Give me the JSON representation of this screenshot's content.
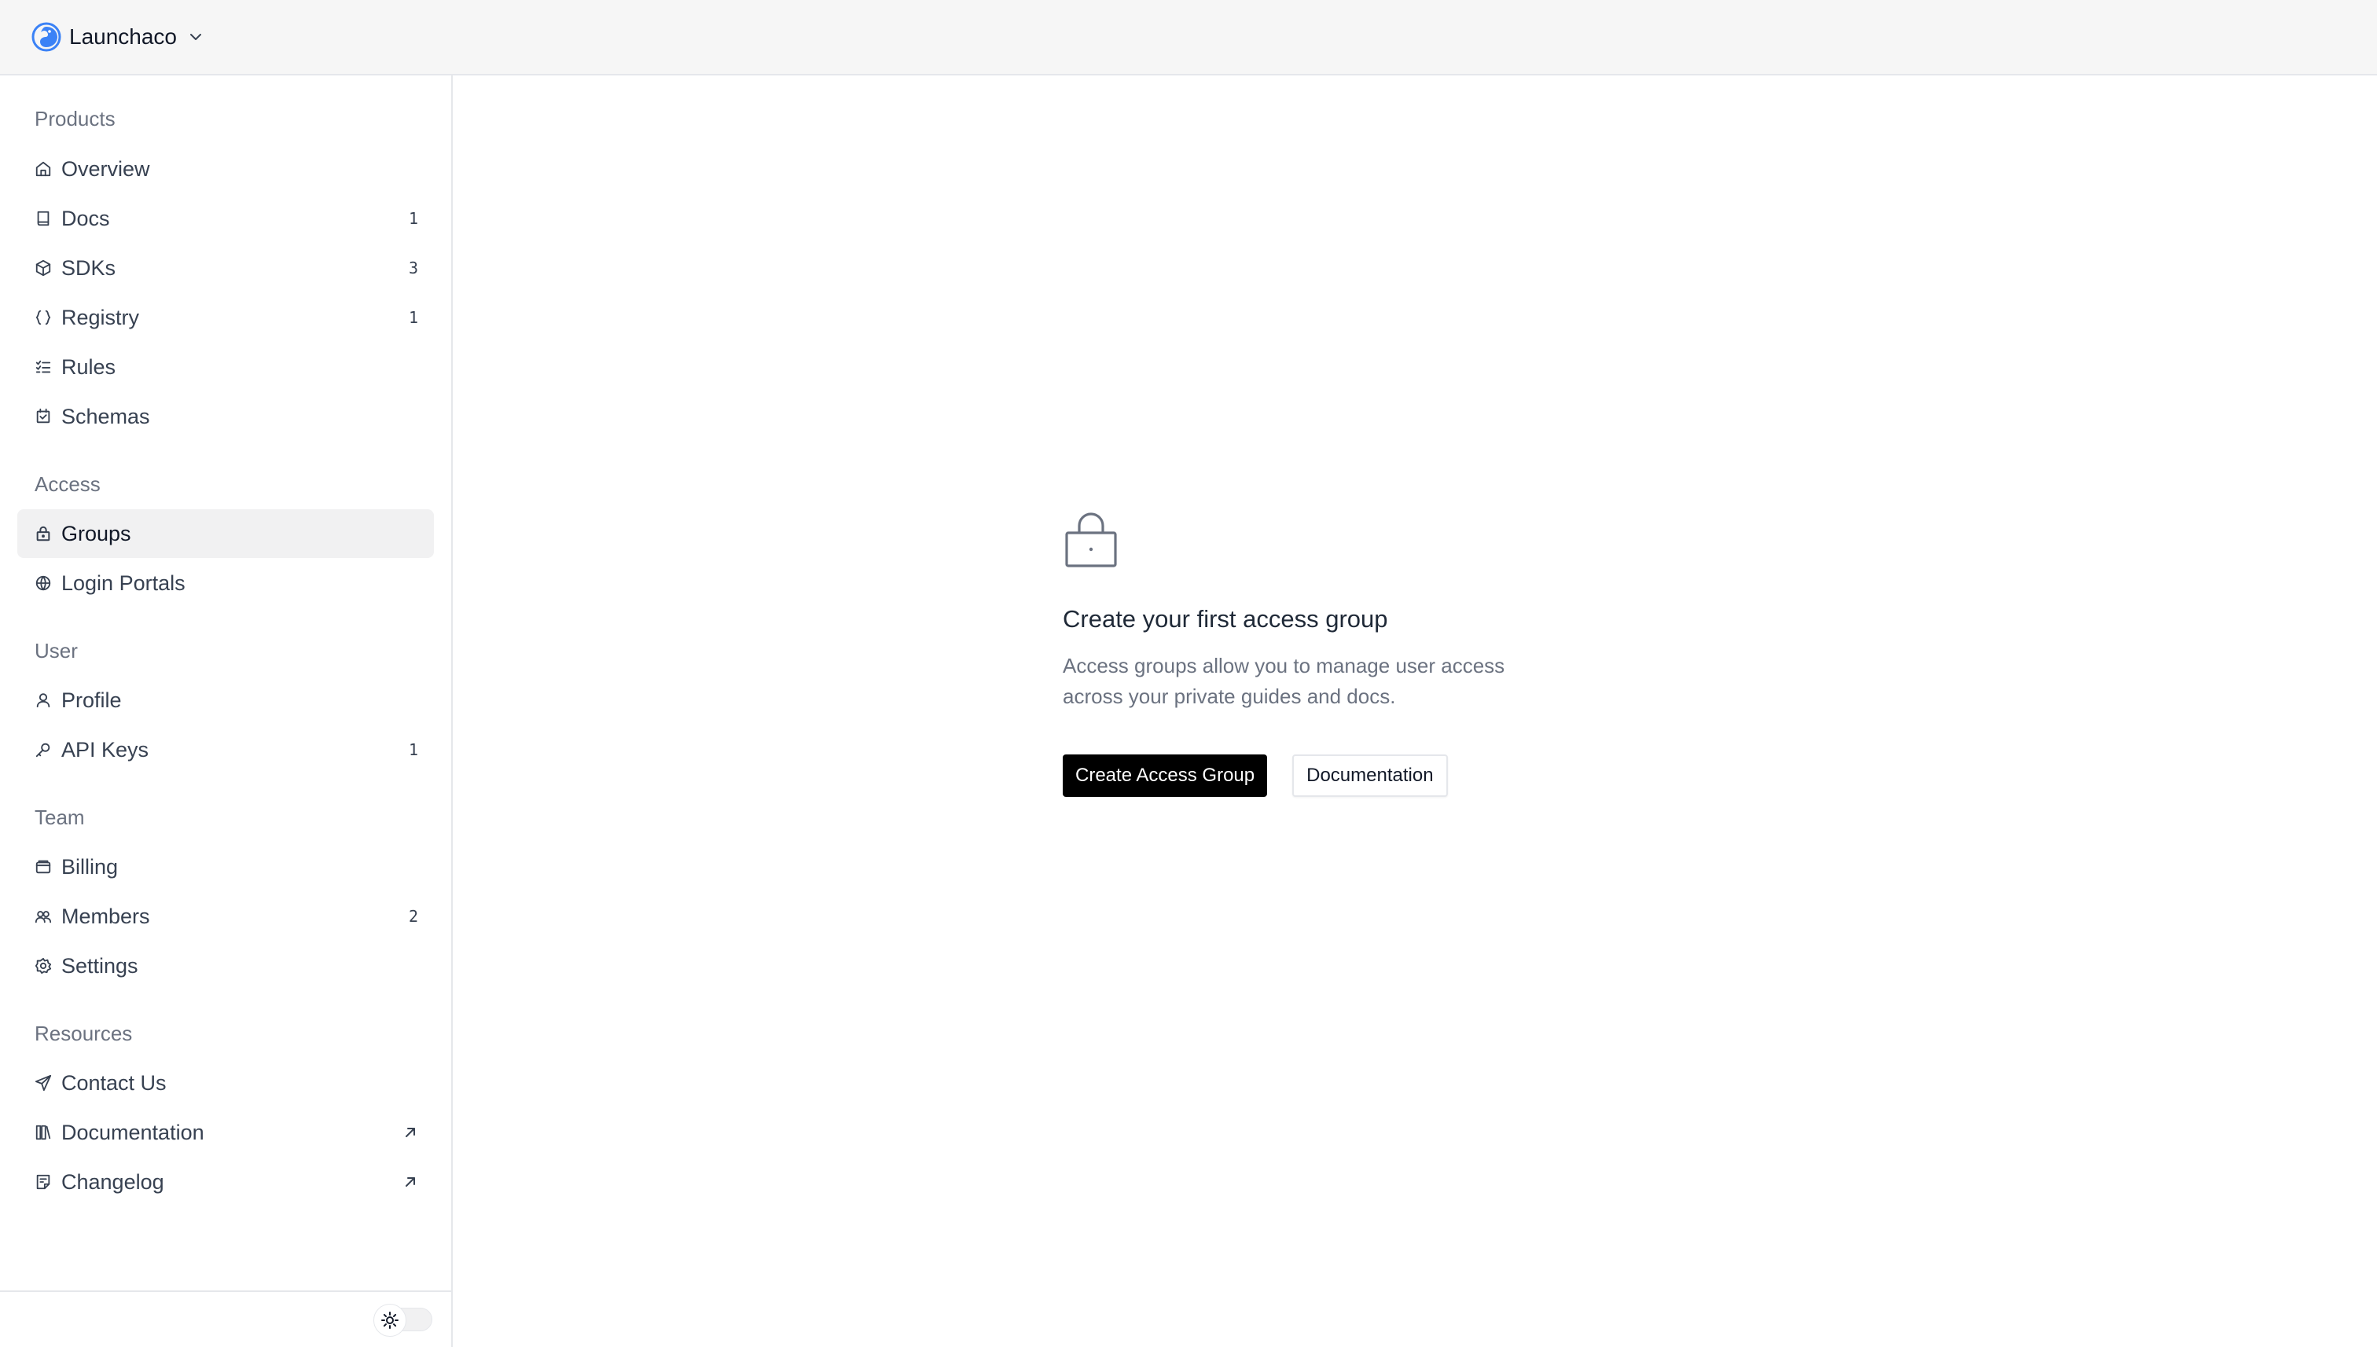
{
  "org": {
    "name": "Launchaco",
    "logo_icon": "launchaco-logo-icon",
    "switch_icon": "chevron-down-icon"
  },
  "sidebar": {
    "sections": [
      {
        "title": "Products",
        "items": [
          {
            "label": "Overview",
            "icon": "home-icon",
            "badge": ""
          },
          {
            "label": "Docs",
            "icon": "book-icon",
            "badge": "1"
          },
          {
            "label": "SDKs",
            "icon": "package-icon",
            "badge": "3"
          },
          {
            "label": "Registry",
            "icon": "braces-icon",
            "badge": "1"
          },
          {
            "label": "Rules",
            "icon": "list-checks-icon",
            "badge": ""
          },
          {
            "label": "Schemas",
            "icon": "schema-icon",
            "badge": ""
          }
        ]
      },
      {
        "title": "Access",
        "items": [
          {
            "label": "Groups",
            "icon": "lock-icon",
            "badge": "",
            "active": true
          },
          {
            "label": "Login Portals",
            "icon": "globe-icon",
            "badge": ""
          }
        ]
      },
      {
        "title": "User",
        "items": [
          {
            "label": "Profile",
            "icon": "user-icon",
            "badge": ""
          },
          {
            "label": "API Keys",
            "icon": "key-icon",
            "badge": "1"
          }
        ]
      },
      {
        "title": "Team",
        "items": [
          {
            "label": "Billing",
            "icon": "wallet-icon",
            "badge": ""
          },
          {
            "label": "Members",
            "icon": "users-icon",
            "badge": "2"
          },
          {
            "label": "Settings",
            "icon": "gear-icon",
            "badge": ""
          }
        ]
      },
      {
        "title": "Resources",
        "items": [
          {
            "label": "Contact Us",
            "icon": "send-icon",
            "badge": ""
          },
          {
            "label": "Documentation",
            "icon": "library-icon",
            "external": true
          },
          {
            "label": "Changelog",
            "icon": "notes-icon",
            "external": true
          }
        ]
      }
    ],
    "footer": {
      "theme_icon": "sun-icon"
    }
  },
  "empty_state": {
    "icon": "lock-icon",
    "title": "Create your first access group",
    "description": "Access groups allow you to manage user access across your private guides and docs.",
    "primary_button": "Create Access Group",
    "secondary_button": "Documentation"
  }
}
